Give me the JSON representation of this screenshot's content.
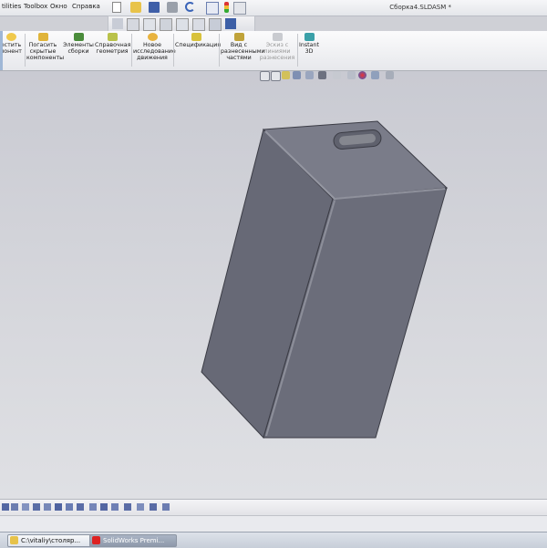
{
  "menubar": {
    "items": [
      "tilities",
      "Toolbox",
      "Окно",
      "Справка"
    ],
    "document_title": "Сборка4.SLDASM *"
  },
  "ribbon": {
    "buttons": [
      {
        "line1": "естить",
        "line2": "понент"
      },
      {
        "line1": "Погасить",
        "line2": "скрытые",
        "line3": "компоненты"
      },
      {
        "line1": "Элементы",
        "line2": "сборки"
      },
      {
        "line1": "Справочная",
        "line2": "геометрия"
      },
      {
        "line1": "Новое",
        "line2": "исследование",
        "line3": "движения"
      },
      {
        "line1": "Спецификация"
      },
      {
        "line1": "Вид с",
        "line2": "разнесенными",
        "line3": "частями"
      },
      {
        "line1": "Эскиз с",
        "line2": "линиями",
        "line3": "разнесения"
      },
      {
        "line1": "Instant",
        "line2": "3D"
      }
    ]
  },
  "taskbar": {
    "items": [
      {
        "label": "C:\\vitaliy\\столяр..."
      },
      {
        "label": "SolidWorks Premi..."
      }
    ]
  },
  "colors": {
    "model_face_front": "#676976",
    "model_face_side": "#6f717d",
    "model_face_top": "#7b7d89",
    "viewport_bg": "#cfd0d6"
  }
}
